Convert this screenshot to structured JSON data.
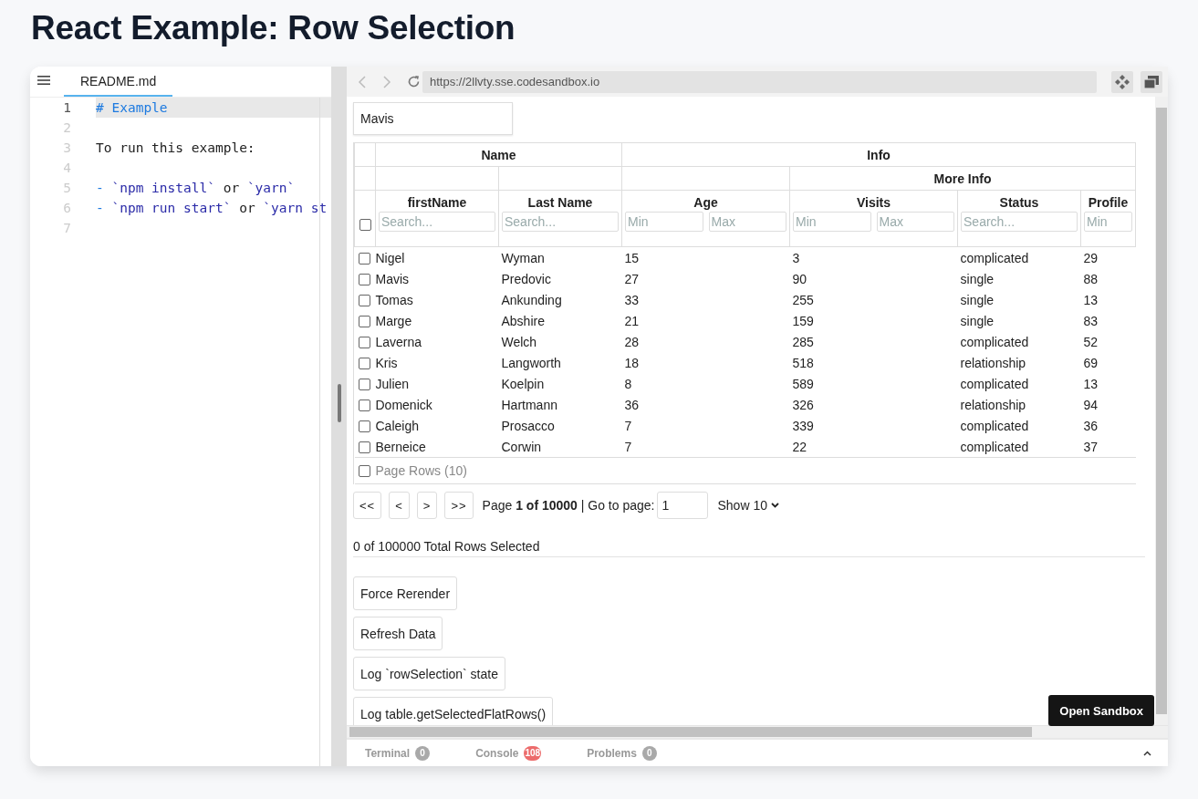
{
  "page_title": "React Example: Row Selection",
  "editor": {
    "tab": "README.md",
    "lines": [
      {
        "number": "1",
        "active": true,
        "segments": [
          {
            "kind": "heading",
            "text": "# Example"
          }
        ]
      },
      {
        "number": "2",
        "active": false
      },
      {
        "number": "3",
        "active": false,
        "segments": [
          {
            "kind": "plain",
            "text": "To run this example:"
          }
        ]
      },
      {
        "number": "4",
        "active": false
      },
      {
        "number": "5",
        "active": false,
        "segments": [
          {
            "kind": "bullet",
            "text": "- "
          },
          {
            "kind": "code",
            "text": "`npm install`"
          },
          {
            "kind": "plain",
            "text": " or "
          },
          {
            "kind": "code",
            "text": "`yarn`"
          }
        ]
      },
      {
        "number": "6",
        "active": false,
        "segments": [
          {
            "kind": "bullet",
            "text": "- "
          },
          {
            "kind": "code",
            "text": "`npm run start`"
          },
          {
            "kind": "plain",
            "text": " or "
          },
          {
            "kind": "code",
            "text": "`yarn st"
          }
        ]
      },
      {
        "number": "7",
        "active": false
      }
    ]
  },
  "browser": {
    "url": "https://2llvty.sse.codesandbox.io"
  },
  "global_filter": {
    "value": "Mavis"
  },
  "table": {
    "header_groups": [
      {
        "kind": "name",
        "label": "Name"
      },
      {
        "kind": "info",
        "label": "Info"
      },
      {
        "kind": "more_info",
        "label": "More Info"
      }
    ],
    "select_all": {
      "checked": false
    },
    "columns": [
      {
        "label": "firstName",
        "placeholders": [
          "Search..."
        ]
      },
      {
        "label": "Last Name",
        "placeholders": [
          "Search..."
        ]
      },
      {
        "label": "Age",
        "placeholders": [
          "Min",
          "Max"
        ]
      },
      {
        "label": "Visits",
        "placeholders": [
          "Min",
          "Max"
        ]
      },
      {
        "label": "Status",
        "placeholders": [
          "Search..."
        ]
      },
      {
        "label": "Profile",
        "placeholders": [
          "Min"
        ]
      }
    ],
    "rows": [
      {
        "checked": false,
        "cells": [
          "Nigel",
          "Wyman",
          "15",
          "3",
          "complicated",
          "29"
        ]
      },
      {
        "checked": false,
        "cells": [
          "Mavis",
          "Predovic",
          "27",
          "90",
          "single",
          "88"
        ]
      },
      {
        "checked": false,
        "cells": [
          "Tomas",
          "Ankunding",
          "33",
          "255",
          "single",
          "13"
        ]
      },
      {
        "checked": false,
        "cells": [
          "Marge",
          "Abshire",
          "21",
          "159",
          "single",
          "83"
        ]
      },
      {
        "checked": false,
        "cells": [
          "Laverna",
          "Welch",
          "28",
          "285",
          "complicated",
          "52"
        ]
      },
      {
        "checked": false,
        "cells": [
          "Kris",
          "Langworth",
          "18",
          "518",
          "relationship",
          "69"
        ]
      },
      {
        "checked": false,
        "cells": [
          "Julien",
          "Koelpin",
          "8",
          "589",
          "complicated",
          "13"
        ]
      },
      {
        "checked": false,
        "cells": [
          "Domenick",
          "Hartmann",
          "36",
          "326",
          "relationship",
          "94"
        ]
      },
      {
        "checked": false,
        "cells": [
          "Caleigh",
          "Prosacco",
          "7",
          "339",
          "complicated",
          "36"
        ]
      },
      {
        "checked": false,
        "cells": [
          "Berneice",
          "Corwin",
          "7",
          "22",
          "complicated",
          "37"
        ]
      }
    ],
    "footer": {
      "label": "Page Rows (10)",
      "checked": false
    }
  },
  "pagination": {
    "buttons": [
      "<<",
      "<",
      ">",
      ">>"
    ],
    "page_info": "Page **1 of 10000**  | Go to page:",
    "page_input": "1",
    "page_size": "Show 10"
  },
  "selection_summary": "0 of 100000 Total Rows Selected",
  "actions": [
    "Force Rerender",
    "Refresh Data",
    "Log `rowSelection` state",
    "Log table.getSelectedFlatRows()"
  ],
  "open_sandbox": "Open Sandbox",
  "bottom_tabs": [
    {
      "label": "Terminal",
      "count": "0",
      "color": "#a9a9a9"
    },
    {
      "label": "Console",
      "count": "108",
      "color": "#ec6b6b"
    },
    {
      "label": "Problems",
      "count": "0",
      "color": "#a9a9a9"
    }
  ]
}
